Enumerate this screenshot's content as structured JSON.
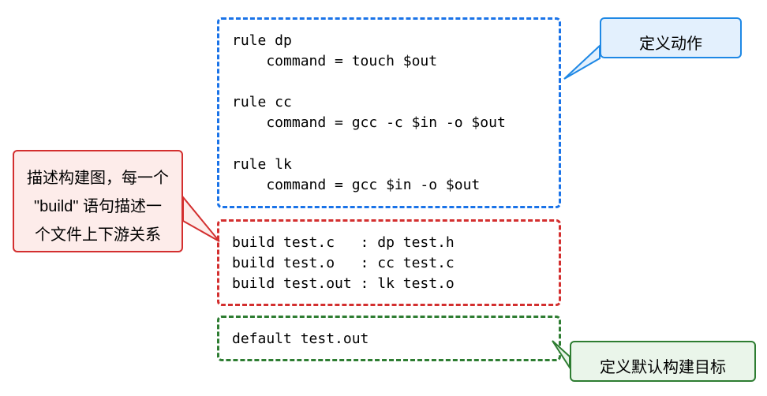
{
  "code": {
    "rules": "rule dp\n    command = touch $out\n\nrule cc\n    command = gcc -c $in -o $out\n\nrule lk\n    command = gcc $in -o $out",
    "builds": "build test.c   : dp test.h\nbuild test.o   : cc test.c\nbuild test.out : lk test.o",
    "default": "default test.out"
  },
  "callouts": {
    "blue": "定义动作",
    "red_line1": "描述构建图，每一个",
    "red_line2": "\"build\" 语句描述一",
    "red_line3": "个文件上下游关系",
    "green": "定义默认构建目标"
  }
}
